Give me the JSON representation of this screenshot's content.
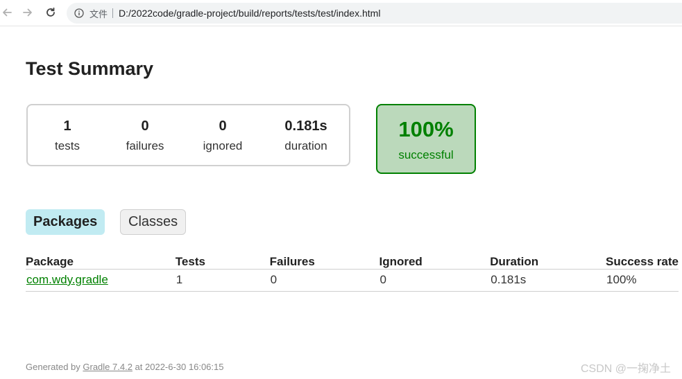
{
  "browser": {
    "scheme_label": "文件",
    "url": "D:/2022code/gradle-project/build/reports/tests/test/index.html"
  },
  "page": {
    "title": "Test Summary"
  },
  "summary": {
    "tests": {
      "value": "1",
      "label": "tests"
    },
    "failures": {
      "value": "0",
      "label": "failures"
    },
    "ignored": {
      "value": "0",
      "label": "ignored"
    },
    "duration": {
      "value": "0.181s",
      "label": "duration"
    },
    "success": {
      "value": "100%",
      "label": "successful"
    }
  },
  "tabs": [
    {
      "label": "Packages",
      "selected": true
    },
    {
      "label": "Classes",
      "selected": false
    }
  ],
  "table": {
    "headers": [
      "Package",
      "Tests",
      "Failures",
      "Ignored",
      "Duration",
      "Success rate"
    ],
    "rows": [
      {
        "package": "com.wdy.gradle",
        "tests": "1",
        "failures": "0",
        "ignored": "0",
        "duration": "0.181s",
        "success_rate": "100%"
      }
    ]
  },
  "footer": {
    "prefix": "Generated by ",
    "link": "Gradle 7.4.2",
    "suffix": " at 2022-6-30 16:06:15"
  },
  "watermark": "CSDN @一掬净土",
  "colors": {
    "success": "#008000",
    "success_bg": "#bbd9bb",
    "selected_tab_bg": "#c1ebf2"
  }
}
